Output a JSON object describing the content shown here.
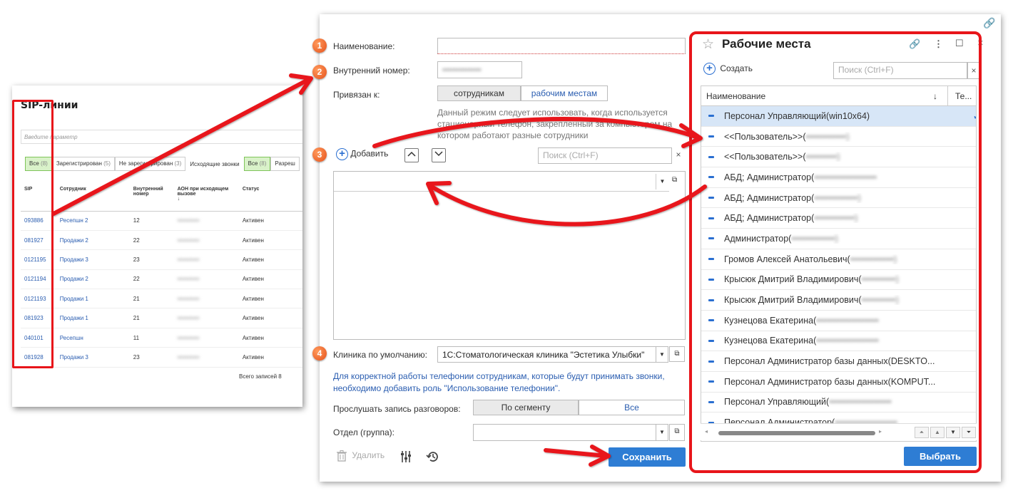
{
  "sip": {
    "title": "SIP-линии",
    "param_placeholder": "Введите параметр",
    "filters": {
      "all_label": "Все",
      "all_count": "(8)",
      "registered_label": "Зарегистрирован",
      "registered_count": "(5)",
      "unregistered_label": "Не зарегистрирован",
      "unregistered_count": "(3)",
      "outgoing_label": "Исходящие звонки",
      "out_all_label": "Все",
      "out_all_count": "(8)",
      "allowed_label": "Разреш"
    },
    "columns": {
      "sip": "SIP",
      "employee": "Сотрудник",
      "internal": "Внутренний номер",
      "aon": "АОН при исходящем вызове",
      "status": "Статус"
    },
    "rows": [
      {
        "sip": "093886",
        "employee": "Ресепшн 2",
        "internal": "12",
        "status": "Активен"
      },
      {
        "sip": "081927",
        "employee": "Продажи 2",
        "internal": "22",
        "status": "Активен"
      },
      {
        "sip": "0121195",
        "employee": "Продажи 3",
        "internal": "23",
        "status": "Активен"
      },
      {
        "sip": "0121194",
        "employee": "Продажи 2",
        "internal": "22",
        "status": "Активен"
      },
      {
        "sip": "0121193",
        "employee": "Продажи 1",
        "internal": "21",
        "status": "Активен"
      },
      {
        "sip": "081923",
        "employee": "Продажи 1",
        "internal": "21",
        "status": "Активен"
      },
      {
        "sip": "040101",
        "employee": "Ресепшн",
        "internal": "11",
        "status": "Активен"
      },
      {
        "sip": "081928",
        "employee": "Продажи 3",
        "internal": "23",
        "status": "Активен"
      }
    ],
    "total": "Всего записей 8"
  },
  "form": {
    "badges": [
      "1",
      "2",
      "3",
      "4"
    ],
    "name_label": "Наименование:",
    "internal_label": "Внутренний номер:",
    "bound_label": "Привязан к:",
    "bound_employees": "сотрудникам",
    "bound_workplaces": "рабочим местам",
    "hint": [
      "Данный режим следует использовать, когда используется",
      "стационарный телефон, закрепленный за компьютером на",
      "котором работают разные сотрудники"
    ],
    "add_label": "Добавить",
    "search_placeholder": "Поиск (Ctrl+F)",
    "clinic_label": "Клиника по умолчанию:",
    "clinic_value": "1С:Стоматологическая клиника \"Эстетика Улыбки\"",
    "note": [
      "Для корректной работы телефонии сотрудникам, которые будут принимать звонки,",
      "необходимо добавить роль \"Использование телефонии\"."
    ],
    "listen_label": "Прослушать запись разговоров:",
    "listen_segment": "По сегменту",
    "listen_all": "Все",
    "dept_label": "Отдел (группа):",
    "delete_label": "Удалить",
    "save_label": "Сохранить"
  },
  "workplaces": {
    "title": "Рабочие места",
    "create_label": "Создать",
    "search_placeholder": "Поиск (Ctrl+F)",
    "col_name": "Наименование",
    "col_tel": "Те...",
    "rows": [
      "Персонал Управляющий(win10x64)",
      "<<Пользователь>>(",
      "<<Пользователь>>(",
      "АБД; Администратор(",
      "АБД; Администратор(",
      "АБД; Администратор(",
      "Администратор(",
      "Громов Алексей Анатольевич(",
      "Крысюк Дмитрий Владимирович(",
      "Крысюк Дмитрий Владимирович(",
      "Кузнецова Екатерина(",
      "Кузнецова Екатерина(",
      "Персонал Администратор базы данных(DESKTO...",
      "Персонал Администратор базы данных(KOMPUT...",
      "Персонал Управляющий(",
      "Персонал Администратор("
    ],
    "select_label": "Выбрать"
  }
}
